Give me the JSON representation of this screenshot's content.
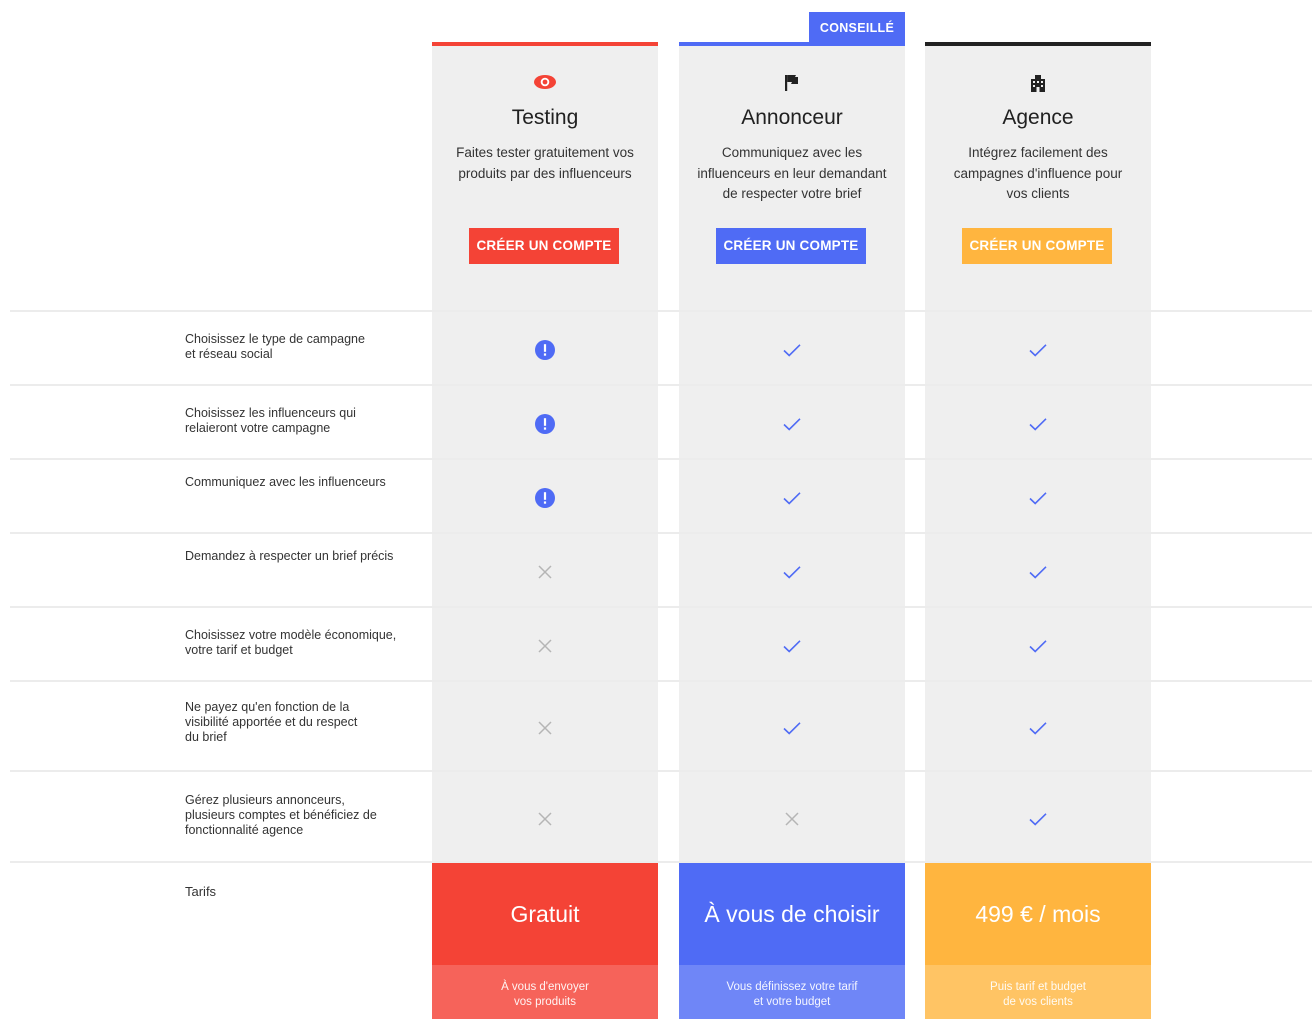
{
  "recommended_badge": "CONSEILLÉ",
  "colors": {
    "red": "#f44336",
    "blue": "#4f6bf5",
    "orange": "#ffb53f",
    "dark": "#222222",
    "check": "#4f6bf5",
    "cross": "#b5b5b5"
  },
  "plans": [
    {
      "icon": "eye-icon",
      "title": "Testing",
      "description_lines": [
        "Faites tester gratuitement vos",
        "produits par des influenceurs"
      ],
      "cta": "CRÉER UN COMPTE",
      "price": "Gratuit",
      "price_note_lines": [
        "À vous d'envoyer",
        "vos produits"
      ]
    },
    {
      "icon": "flag-icon",
      "title": "Annonceur",
      "description_lines": [
        "Communiquez avec les",
        "influenceurs en leur demandant",
        "de respecter votre brief"
      ],
      "cta": "CRÉER UN COMPTE",
      "price": "À vous de choisir",
      "price_note_lines": [
        "Vous définissez votre tarif",
        "et votre budget"
      ]
    },
    {
      "icon": "building-icon",
      "title": "Agence",
      "description_lines": [
        "Intégrez facilement des",
        "campagnes d'influence pour",
        "vos clients"
      ],
      "cta": "CRÉER UN COMPTE",
      "price": "499 € / mois",
      "price_note_lines": [
        "Puis tarif et budget",
        "de vos clients"
      ]
    }
  ],
  "features": [
    {
      "label_lines": [
        "Choisissez le type de campagne",
        "et réseau social"
      ],
      "values": [
        "info",
        "check",
        "check"
      ]
    },
    {
      "label_lines": [
        "Choisissez les influenceurs qui",
        "relaieront votre campagne"
      ],
      "values": [
        "info",
        "check",
        "check"
      ]
    },
    {
      "label_lines": [
        "Communiquez avec les influenceurs"
      ],
      "values": [
        "info",
        "check",
        "check"
      ]
    },
    {
      "label_lines": [
        "Demandez à respecter un brief précis"
      ],
      "values": [
        "cross",
        "check",
        "check"
      ]
    },
    {
      "label_lines": [
        "Choisissez votre modèle économique,",
        "votre tarif et budget"
      ],
      "values": [
        "cross",
        "check",
        "check"
      ]
    },
    {
      "label_lines": [
        "Ne payez qu'en fonction de la",
        "visibilité apportée et du respect",
        "du brief"
      ],
      "values": [
        "cross",
        "check",
        "check"
      ]
    },
    {
      "label_lines": [
        "Gérez plusieurs annonceurs,",
        "plusieurs comptes et bénéficiez de",
        "fonctionnalité agence"
      ],
      "values": [
        "cross",
        "cross",
        "check"
      ]
    }
  ],
  "tarifs_label": "Tarifs"
}
